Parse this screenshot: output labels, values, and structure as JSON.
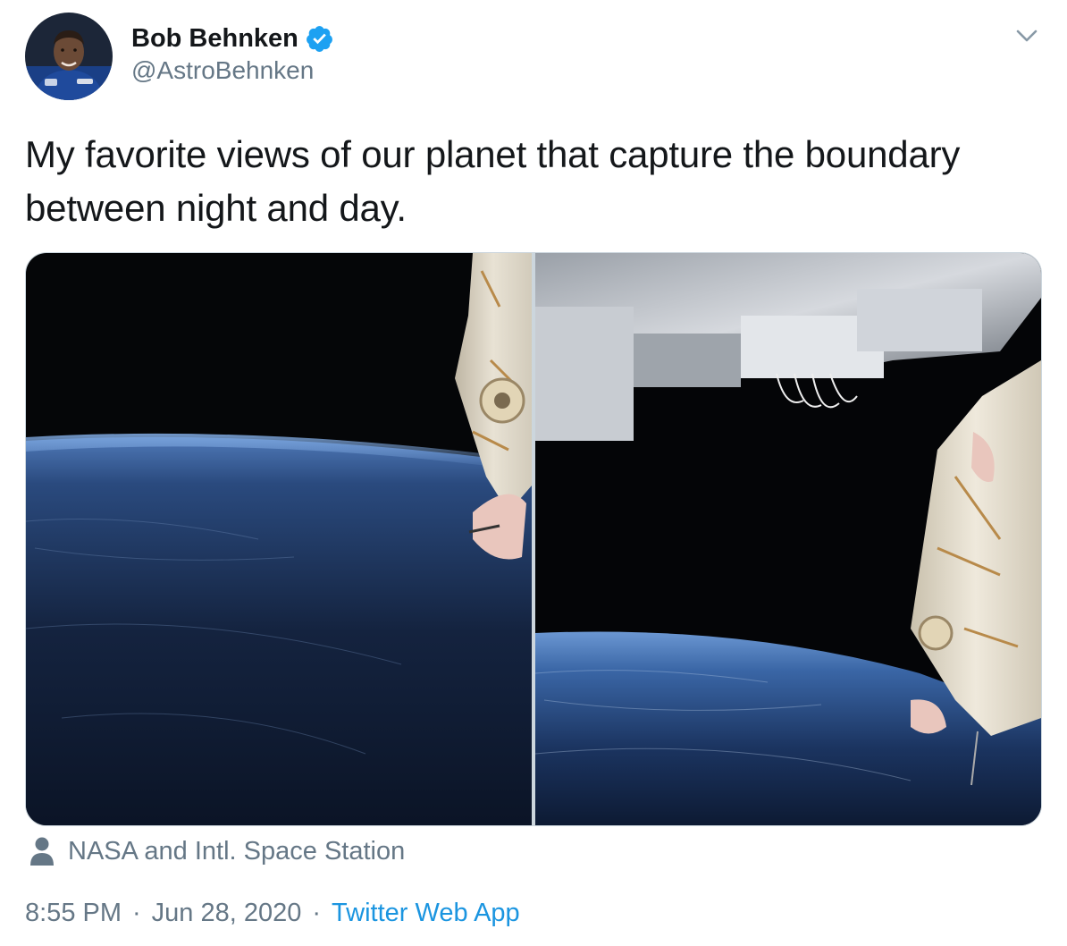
{
  "author": {
    "display_name": "Bob Behnken",
    "handle": "@AstroBehnken",
    "verified": true,
    "avatar_icon": "astronaut-portrait"
  },
  "tweet": {
    "text": "My favorite views of our planet that capture the boundary between night and day."
  },
  "media": {
    "photos": [
      {
        "subject": "earth-horizon-with-iss-module"
      },
      {
        "subject": "earth-horizon-under-iss-structure"
      }
    ],
    "tagged": "NASA and Intl. Space Station"
  },
  "meta": {
    "time": "8:55 PM",
    "date": "Jun 28, 2020",
    "source": "Twitter Web App",
    "separator": "·"
  },
  "colors": {
    "text": "#14171a",
    "secondary": "#657786",
    "link": "#1b95e0",
    "verified": "#1da1f2",
    "border": "#ccd6dd"
  }
}
